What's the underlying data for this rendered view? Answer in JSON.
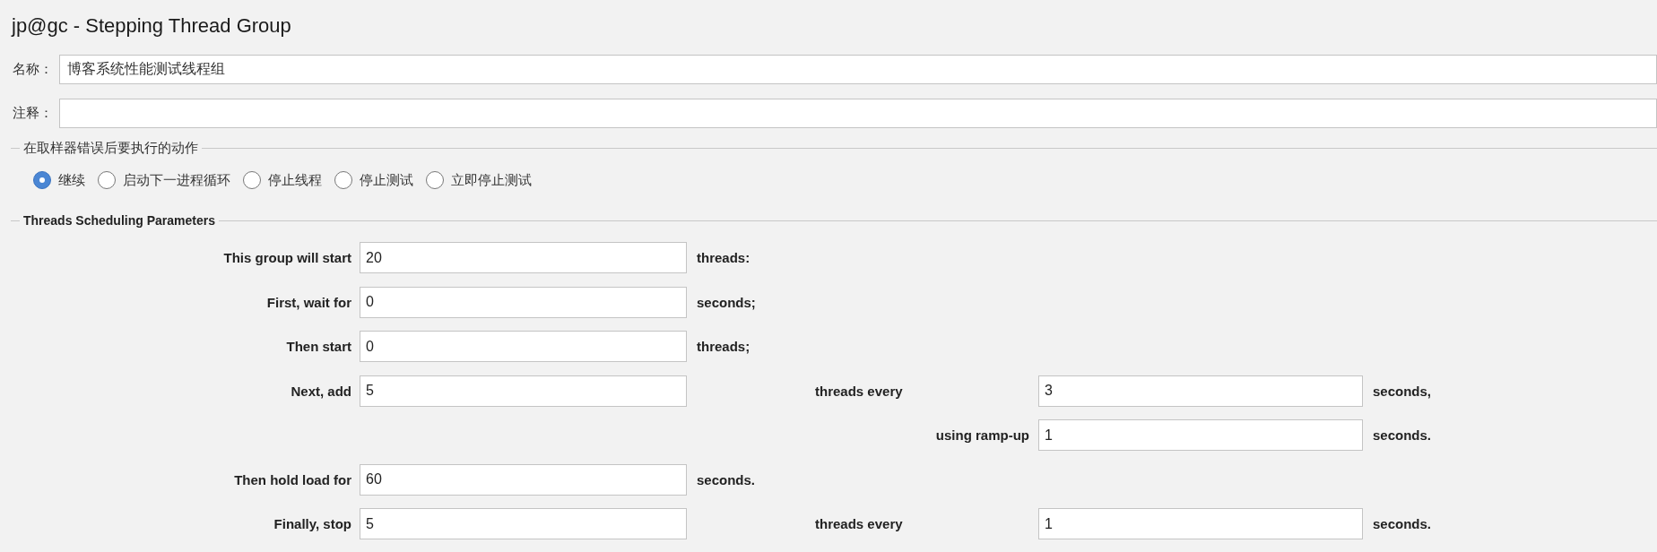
{
  "title": "jp@gc - Stepping Thread Group",
  "name_field": {
    "label": "名称：",
    "value": "博客系统性能测试线程组"
  },
  "comment_field": {
    "label": "注释："
  },
  "sampler_error_action": {
    "legend": "在取样器错误后要执行的动作",
    "options": [
      {
        "label": "继续",
        "selected": true
      },
      {
        "label": "启动下一进程循环",
        "selected": false
      },
      {
        "label": "停止线程",
        "selected": false
      },
      {
        "label": "停止测试",
        "selected": false
      },
      {
        "label": "立即停止测试",
        "selected": false
      }
    ]
  },
  "scheduling": {
    "legend": "Threads Scheduling Parameters",
    "rows": [
      {
        "kind": "single",
        "label": "This group will start",
        "value": "20",
        "unit": "threads:"
      },
      {
        "kind": "single",
        "label": "First, wait for",
        "value": "0",
        "unit": "seconds;"
      },
      {
        "kind": "single",
        "label": "Then start",
        "value": "0",
        "unit": "threads;"
      },
      {
        "kind": "double",
        "label": "Next, add",
        "value": "5",
        "label_2": "threads every",
        "value_2": "3",
        "unit_2": "seconds,"
      },
      {
        "kind": "ramp",
        "label_2": "using ramp-up",
        "value_2": "1",
        "unit_2": "seconds."
      },
      {
        "kind": "single",
        "label": "Then hold load for",
        "value": "60",
        "unit": "seconds."
      },
      {
        "kind": "double",
        "label": "Finally, stop",
        "value": "5",
        "label_2": "threads every",
        "value_2": "1",
        "unit_2": "seconds."
      }
    ]
  }
}
